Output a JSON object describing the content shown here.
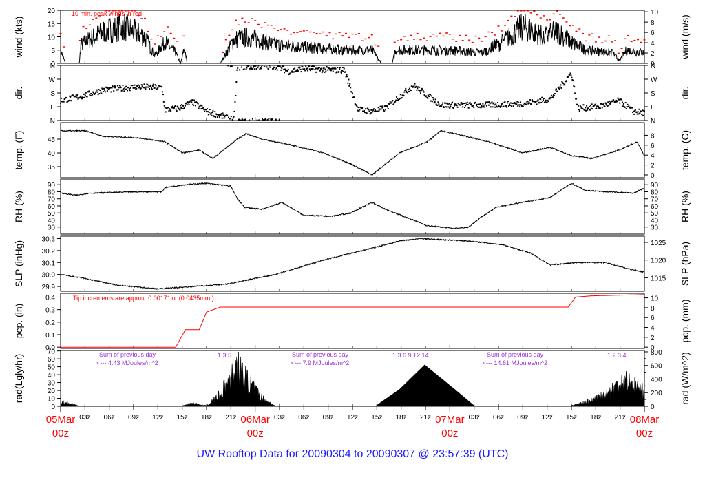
{
  "title": "UW Rooftop Data for 20090304  to  20090307 @ 23:57:39  (UTC)",
  "colors": {
    "line": "#000000",
    "peak": "#ff0000",
    "pcp": "#ff0000",
    "date": "#ff0000",
    "title": "#1a1aff",
    "rad_note": "#9a30e0"
  },
  "chart_data": [
    {
      "type": "line",
      "id": "wind",
      "ylabel": "wind (kts)",
      "ylabel_right": "wind (m/s)",
      "ylim": [
        0,
        20
      ],
      "yticks": [
        0,
        5,
        10,
        15,
        20
      ],
      "yticks_right": [
        0,
        2,
        4,
        6,
        8,
        10
      ],
      "right_scale": 0.5144,
      "annotation": "10 min. peak winds in red",
      "x_unit": "hours since 05Mar 00z",
      "mean_points": [
        [
          0,
          5
        ],
        [
          0.6,
          0
        ],
        [
          2.3,
          0
        ],
        [
          2.5,
          7
        ],
        [
          5.3,
          12
        ],
        [
          7.8,
          14
        ],
        [
          10.4,
          10
        ],
        [
          11.6,
          3
        ],
        [
          12.9,
          8
        ],
        [
          14.2,
          4
        ],
        [
          14.8,
          0
        ],
        [
          15.3,
          6
        ],
        [
          15.6,
          0
        ],
        [
          19.7,
          0
        ],
        [
          21.4,
          9
        ],
        [
          23.1,
          10
        ],
        [
          26.5,
          7
        ],
        [
          30.7,
          6
        ],
        [
          35,
          5
        ],
        [
          38.4,
          5
        ],
        [
          39.6,
          0
        ],
        [
          40.9,
          0
        ],
        [
          41.3,
          5
        ],
        [
          47.7,
          5
        ],
        [
          52,
          4
        ],
        [
          54.5,
          8
        ],
        [
          57,
          14
        ],
        [
          59.6,
          10
        ],
        [
          61.3,
          12
        ],
        [
          63,
          8
        ],
        [
          64.7,
          5
        ],
        [
          68.1,
          4
        ],
        [
          68.9,
          1
        ],
        [
          69.8,
          5
        ],
        [
          72,
          4
        ]
      ]
    },
    {
      "type": "scatter",
      "id": "dir",
      "ylabel": "dir.",
      "ylabel_right": "dir.",
      "ylim": [
        0,
        360
      ],
      "ytick_labels": [
        "N",
        "E",
        "S",
        "W",
        "N"
      ],
      "points": [
        [
          0,
          130
        ],
        [
          2.7,
          160
        ],
        [
          5.3,
          200
        ],
        [
          9.5,
          220
        ],
        [
          12.5,
          215
        ],
        [
          12.9,
          70
        ],
        [
          14.6,
          80
        ],
        [
          16.3,
          120
        ],
        [
          18,
          60
        ],
        [
          21.4,
          5
        ],
        [
          21.8,
          350
        ],
        [
          26.5,
          355
        ],
        [
          28.2,
          320
        ],
        [
          29.9,
          340
        ],
        [
          33.3,
          330
        ],
        [
          35,
          330
        ],
        [
          36.7,
          70
        ],
        [
          38.4,
          60
        ],
        [
          40.1,
          80
        ],
        [
          43.5,
          230
        ],
        [
          46.9,
          100
        ],
        [
          52,
          100
        ],
        [
          57,
          110
        ],
        [
          60.4,
          140
        ],
        [
          63,
          310
        ],
        [
          63.8,
          80
        ],
        [
          66.4,
          90
        ],
        [
          68.9,
          130
        ],
        [
          70.6,
          60
        ],
        [
          72,
          50
        ]
      ]
    },
    {
      "type": "line",
      "id": "temp",
      "ylabel": "temp. (F)",
      "ylabel_right": "temp. (C)",
      "ylim": [
        31,
        51
      ],
      "yticks": [
        35,
        40,
        45
      ],
      "yticks_right": [
        0,
        2,
        4,
        6,
        8
      ],
      "points": [
        [
          0,
          48
        ],
        [
          3.1,
          48
        ],
        [
          5.3,
          46
        ],
        [
          9.5,
          45.5
        ],
        [
          12.9,
          44
        ],
        [
          15,
          40
        ],
        [
          17.1,
          41
        ],
        [
          18.8,
          38
        ],
        [
          21.8,
          45
        ],
        [
          22.9,
          47
        ],
        [
          24.8,
          45
        ],
        [
          28.2,
          43
        ],
        [
          32.4,
          40
        ],
        [
          35.8,
          36
        ],
        [
          38.4,
          32
        ],
        [
          41.8,
          40
        ],
        [
          45.2,
          44
        ],
        [
          46.9,
          48
        ],
        [
          48.6,
          47
        ],
        [
          52.8,
          44
        ],
        [
          57,
          40
        ],
        [
          60.4,
          42
        ],
        [
          63,
          39
        ],
        [
          65.5,
          38
        ],
        [
          68.9,
          41
        ],
        [
          71.1,
          44
        ],
        [
          72,
          39
        ]
      ]
    },
    {
      "type": "line",
      "id": "rh",
      "ylabel": "RH (%)",
      "ylabel_right": "RH (%)",
      "ylim": [
        20,
        98
      ],
      "yticks": [
        30,
        40,
        50,
        60,
        70,
        80,
        90
      ],
      "yticks_right": [
        30,
        40,
        50,
        60,
        70,
        80,
        90
      ],
      "points": [
        [
          0,
          78
        ],
        [
          1.9,
          75
        ],
        [
          3.6,
          78
        ],
        [
          9.5,
          80
        ],
        [
          12.5,
          80
        ],
        [
          12.9,
          86
        ],
        [
          15.4,
          90
        ],
        [
          18,
          92
        ],
        [
          21,
          88
        ],
        [
          21.8,
          70
        ],
        [
          22.7,
          58
        ],
        [
          24.8,
          55
        ],
        [
          27.3,
          65
        ],
        [
          29.9,
          47
        ],
        [
          33.3,
          45
        ],
        [
          35.8,
          50
        ],
        [
          38.4,
          65
        ],
        [
          40.1,
          55
        ],
        [
          43.5,
          40
        ],
        [
          45.2,
          32
        ],
        [
          48.6,
          28
        ],
        [
          50.3,
          30
        ],
        [
          52,
          45
        ],
        [
          53.7,
          58
        ],
        [
          57,
          65
        ],
        [
          60.4,
          72
        ],
        [
          63,
          92
        ],
        [
          64.7,
          82
        ],
        [
          67.2,
          80
        ],
        [
          70.6,
          78
        ],
        [
          72,
          85
        ]
      ]
    },
    {
      "type": "line",
      "id": "slp",
      "ylabel": "SLP (inHg)",
      "ylabel_right": "SLP (hPa)",
      "ylim": [
        29.86,
        30.32
      ],
      "yticks": [
        29.9,
        30.0,
        30.1,
        30.2,
        30.3
      ],
      "yticks_right": [
        1015,
        1020,
        1025
      ],
      "points": [
        [
          0,
          30.0
        ],
        [
          2.7,
          29.97
        ],
        [
          7,
          29.91
        ],
        [
          12.1,
          29.88
        ],
        [
          16.3,
          29.9
        ],
        [
          20.5,
          29.92
        ],
        [
          26.5,
          30.0
        ],
        [
          32.4,
          30.12
        ],
        [
          38.4,
          30.22
        ],
        [
          41.8,
          30.28
        ],
        [
          44.3,
          30.3
        ],
        [
          50.3,
          30.28
        ],
        [
          54.5,
          30.25
        ],
        [
          57.9,
          30.18
        ],
        [
          60.4,
          30.08
        ],
        [
          63.8,
          30.1
        ],
        [
          67.2,
          30.1
        ],
        [
          69.8,
          30.05
        ],
        [
          72,
          30.02
        ]
      ]
    },
    {
      "type": "line",
      "id": "pcp",
      "ylabel": "pcp. (in)",
      "ylabel_right": "pcp. (mm)",
      "ylim": [
        -0.01,
        0.43
      ],
      "yticks": [
        0.0,
        0.1,
        0.2,
        0.3,
        0.4
      ],
      "yticks_right": [
        0,
        2,
        4,
        6,
        8,
        10
      ],
      "annotation": "Tip increments are approx. 0.00171in. (0.0435mm.)",
      "points": [
        [
          0,
          0
        ],
        [
          14.2,
          0
        ],
        [
          15.4,
          0.14
        ],
        [
          17.1,
          0.14
        ],
        [
          18,
          0.28
        ],
        [
          19.7,
          0.32
        ],
        [
          62.6,
          0.32
        ],
        [
          63.5,
          0.4
        ],
        [
          65.5,
          0.41
        ],
        [
          72,
          0.42
        ]
      ]
    },
    {
      "type": "area",
      "id": "rad",
      "ylabel": "rad(Lgly/hr)",
      "ylabel_right": "rad (W/m^2)",
      "ylim": [
        0,
        820
      ],
      "yticks_left": [
        0,
        10,
        20,
        30,
        40,
        50,
        60,
        70
      ],
      "yticks_right": [
        0,
        100,
        200,
        300,
        400,
        500,
        600,
        700,
        800
      ],
      "yticks_right_labels": [
        0,
        200,
        400,
        600,
        800
      ],
      "points": [
        [
          0,
          80
        ],
        [
          1.9,
          20
        ],
        [
          2.5,
          0
        ],
        [
          14.6,
          0
        ],
        [
          16.3,
          50
        ],
        [
          18,
          10
        ],
        [
          19.7,
          200
        ],
        [
          21,
          500
        ],
        [
          21.8,
          700
        ],
        [
          22.9,
          450
        ],
        [
          24.8,
          150
        ],
        [
          26.5,
          0
        ],
        [
          38.8,
          0
        ],
        [
          41.8,
          250
        ],
        [
          44.9,
          610
        ],
        [
          48.6,
          250
        ],
        [
          51.1,
          0
        ],
        [
          62.6,
          0
        ],
        [
          65.5,
          100
        ],
        [
          67.2,
          200
        ],
        [
          69.8,
          450
        ],
        [
          71.1,
          300
        ],
        [
          72,
          250
        ]
      ],
      "notes": [
        {
          "line1": "Sum of previous day",
          "line2": "<--- 4.43 MJoules/m^2",
          "hours": "1   3   5"
        },
        {
          "line1": "Sum of previous day",
          "line2": "<--- 7.9 MJoules/m^2",
          "hours": "1   3   6   9   12  14"
        },
        {
          "line1": "Sum of previous day",
          "line2": "<--- 14.61 MJoules/m^2",
          "hours": "1   2   3   4"
        }
      ]
    }
  ],
  "x_axis": {
    "hour_labels": [
      "03z",
      "06z",
      "09z",
      "12z",
      "15z",
      "18z",
      "21z"
    ],
    "day_labels": [
      {
        "date": "05Mar",
        "hour": "00z"
      },
      {
        "date": "06Mar",
        "hour": "00z"
      },
      {
        "date": "07Mar",
        "hour": "00z"
      },
      {
        "date": "08Mar",
        "hour": "00z"
      }
    ],
    "range_hours": [
      0,
      72
    ]
  }
}
